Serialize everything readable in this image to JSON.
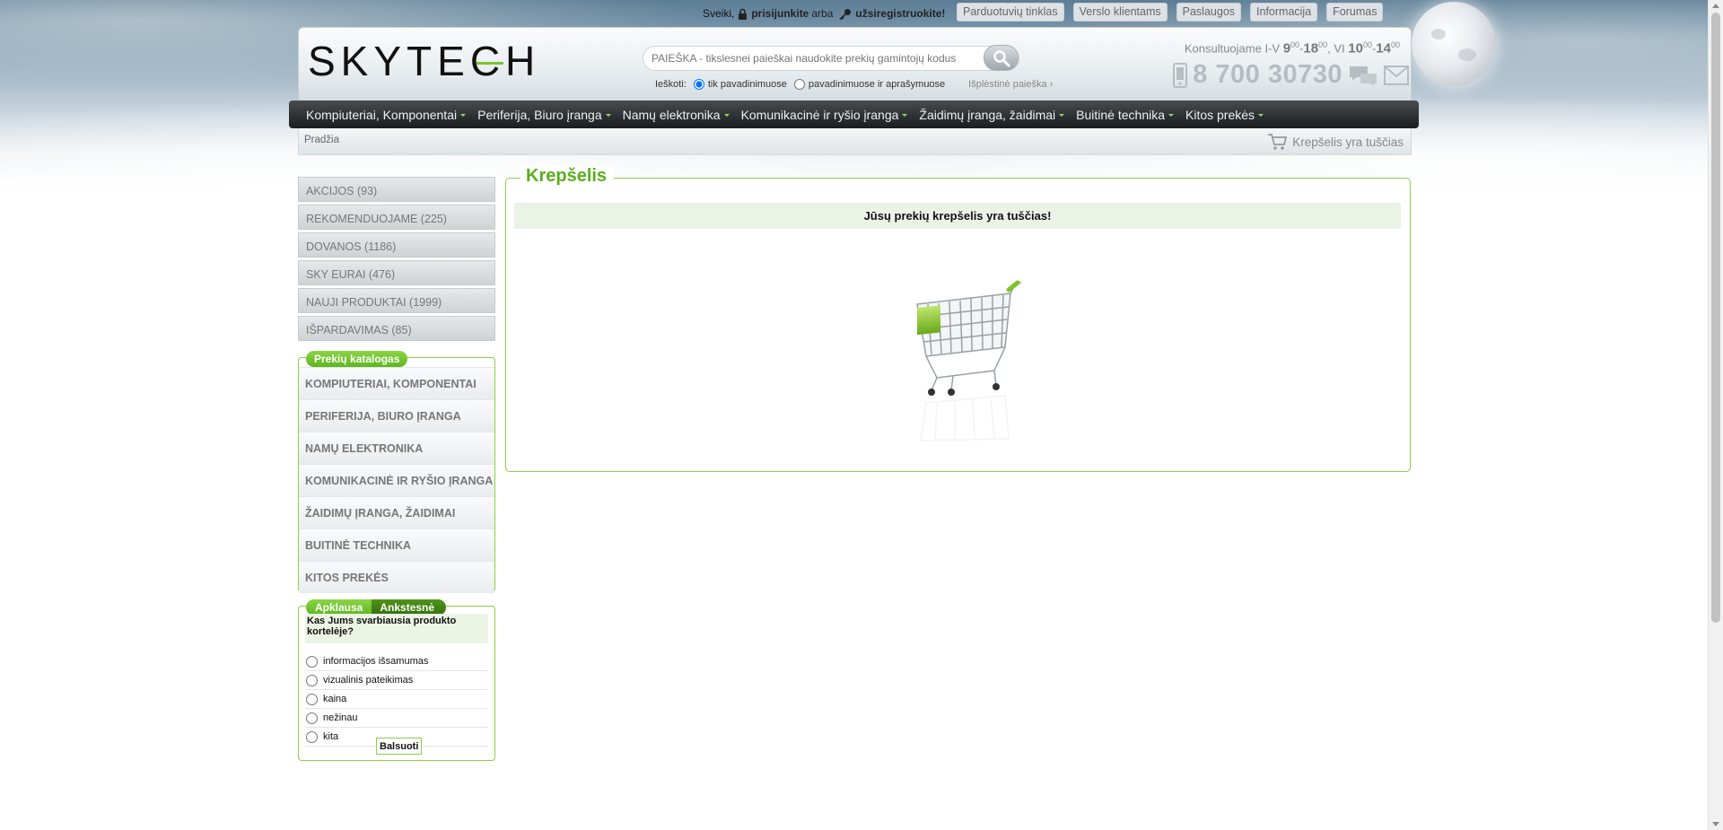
{
  "topbar": {
    "greeting": "Sveiki,",
    "login": "prisijunkite",
    "or": "arba",
    "register": "užsiregistruokite!",
    "links": [
      "Parduotuvių tinklas",
      "Verslo klientams",
      "Paslaugos",
      "Informacija",
      "Forumas"
    ]
  },
  "header": {
    "logo": "SKYTECH",
    "search_placeholder": "PAIEŠKA - tikslesnei paieškai naudokite prekių gamintojų kodus",
    "search_label": "Ieškoti:",
    "opt_names": "tik pavadinimuose",
    "opt_desc": "pavadinimuose ir aprašymuose",
    "advanced": "Išplėstinė paieška ›",
    "consult": "Konsultuojame I-V",
    "h1": "9",
    "m1": "00",
    "dash": "-",
    "h2": "18",
    "m2": "00",
    "sat": ", VI",
    "h3": "10",
    "m3": "00",
    "h4": "14",
    "m4": "00",
    "phone": "8 700 30730"
  },
  "nav": [
    "Kompiuteriai, Komponentai",
    "Periferija, Biuro įranga",
    "Namų elektronika",
    "Komunikacinė ir ryšio įranga",
    "Žaidimų įranga, žaidimai",
    "Buitinė technika",
    "Kitos prekės"
  ],
  "breadcrumb": "Pradžia",
  "cart_link": "Krepšelis yra tuščias",
  "promos": [
    "AKCIJOS (93)",
    "REKOMENDUOJAME (225)",
    "DOVANOS (1186)",
    "SKY EURAI (476)",
    "NAUJI PRODUKTAI (1999)",
    "IŠPARDAVIMAS (85)"
  ],
  "catalog": {
    "title": "Prekių katalogas",
    "items": [
      "KOMPIUTERIAI, KOMPONENTAI",
      "PERIFERIJA, BIURO ĮRANGA",
      "NAMŲ ELEKTRONIKA",
      "KOMUNIKACINĖ IR RYŠIO ĮRANGA",
      "ŽAIDIMŲ ĮRANGA, ŽAIDIMAI",
      "BUITINĖ TECHNIKA",
      "KITOS PREKĖS"
    ]
  },
  "poll": {
    "tab1": "Apklausa",
    "tab2": "Ankstesnė",
    "question": "Kas Jums svarbiausia produkto kortelėje?",
    "options": [
      "informacijos išsamumas",
      "vizualinis pateikimas",
      "kaina",
      "nežinau",
      "kita"
    ],
    "vote": "Balsuoti"
  },
  "cart": {
    "title": "Krepšelis",
    "empty": "Jūsų prekių krepšelis yra tuščias!"
  },
  "colors": {
    "accent": "#5aae1d",
    "nav": "#2a2d30"
  }
}
